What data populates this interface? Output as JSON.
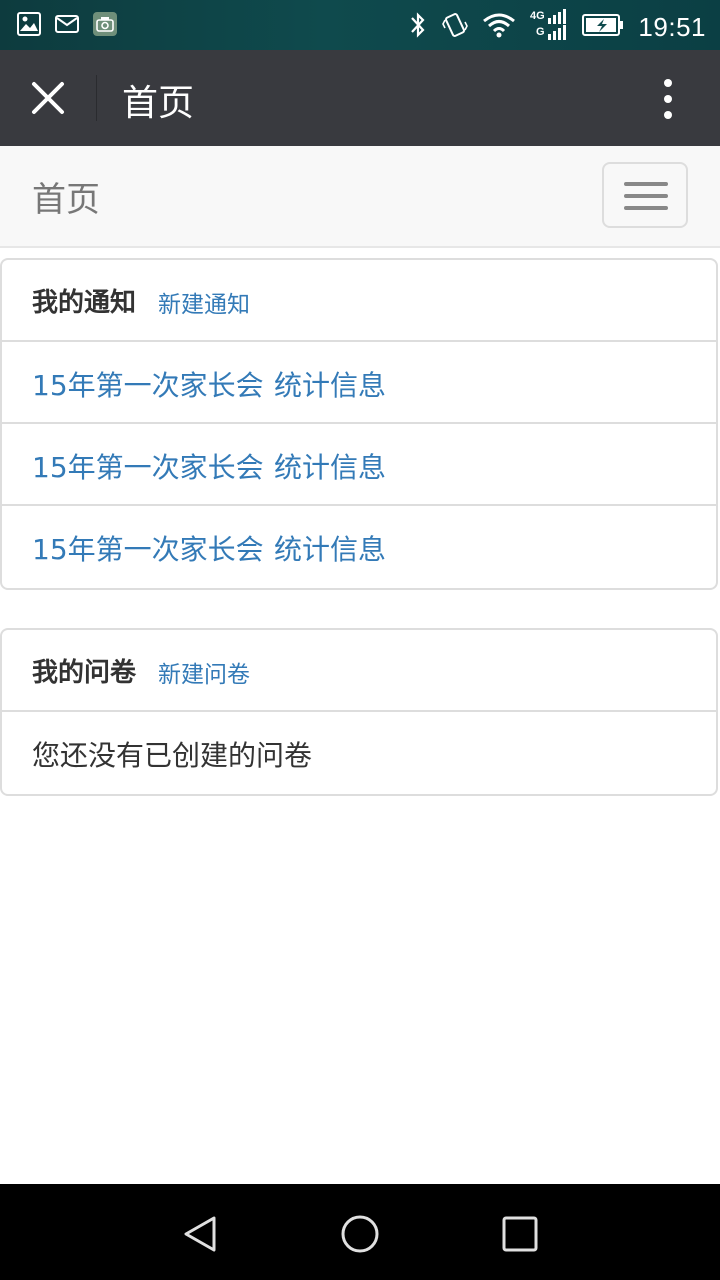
{
  "status_bar": {
    "time": "19:51",
    "network": "4G",
    "left_icons": [
      "image-icon",
      "mail-icon",
      "camera-app-icon"
    ],
    "right_icons": [
      "bluetooth-icon",
      "vibrate-icon",
      "wifi-icon",
      "signal-icon",
      "battery-icon"
    ]
  },
  "toolbar": {
    "title": "首页",
    "close_icon": "close-icon",
    "more_icon": "more-vertical-icon"
  },
  "navbar": {
    "brand": "首页",
    "toggle_icon": "hamburger-icon"
  },
  "notices": {
    "title": "我的通知",
    "new_link": "新建通知",
    "items": [
      {
        "name": "15年第一次家长会",
        "stats": "统计信息"
      },
      {
        "name": "15年第一次家长会",
        "stats": "统计信息"
      },
      {
        "name": "15年第一次家长会",
        "stats": "统计信息"
      }
    ]
  },
  "surveys": {
    "title": "我的问卷",
    "new_link": "新建问卷",
    "empty_text": "您还没有已创建的问卷"
  },
  "system_nav": {
    "icons": [
      "back-icon",
      "home-icon",
      "recents-icon"
    ]
  },
  "colors": {
    "status_bar": "#0f4a4d",
    "toolbar": "#393a3f",
    "navbar": "#f8f8f8",
    "link": "#337ab7",
    "border": "#dddddd"
  }
}
